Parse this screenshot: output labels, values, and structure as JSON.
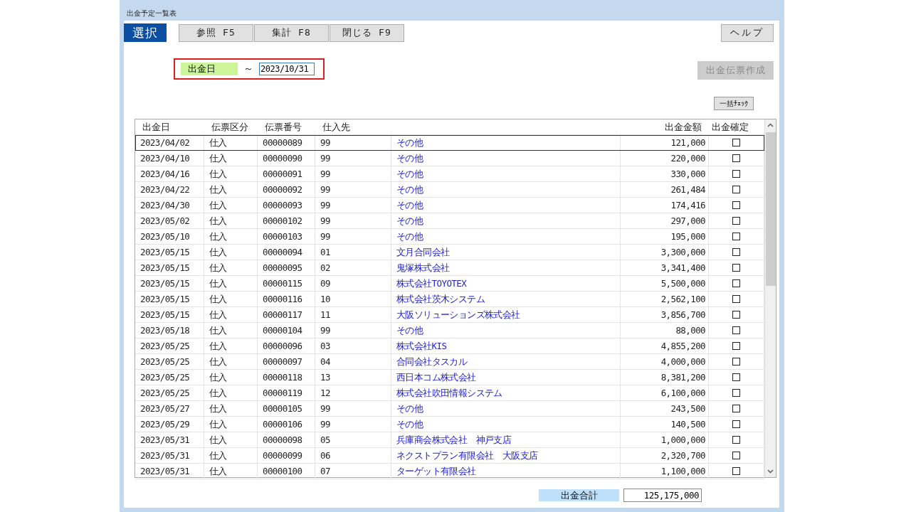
{
  "window": {
    "title": "出金予定一覧表"
  },
  "toolbar": [
    {
      "label": "選択",
      "selected": true
    },
    {
      "label": "参照 F5",
      "selected": false
    },
    {
      "label": "集計 F8",
      "selected": false
    },
    {
      "label": "閉じる F9",
      "selected": false
    }
  ],
  "help_button": "ヘルプ",
  "filter": {
    "label": "出金日",
    "separator": "～",
    "value": "2023/10/31"
  },
  "create_button": {
    "label": "出金伝票作成",
    "disabled": true
  },
  "bulk_check_button": "一括ﾁｪｯｸ",
  "table": {
    "columns": [
      "出金日",
      "伝票区分",
      "伝票番号",
      "仕入先",
      "出金金額",
      "出金確定"
    ],
    "rows": [
      {
        "date": "2023/04/02",
        "type": "仕入",
        "number": "00000089",
        "code": "99",
        "supplier": "その他",
        "amount": "121,000",
        "checked": false,
        "selected": true
      },
      {
        "date": "2023/04/10",
        "type": "仕入",
        "number": "00000090",
        "code": "99",
        "supplier": "その他",
        "amount": "220,000",
        "checked": false,
        "selected": false
      },
      {
        "date": "2023/04/16",
        "type": "仕入",
        "number": "00000091",
        "code": "99",
        "supplier": "その他",
        "amount": "330,000",
        "checked": false,
        "selected": false
      },
      {
        "date": "2023/04/22",
        "type": "仕入",
        "number": "00000092",
        "code": "99",
        "supplier": "その他",
        "amount": "261,484",
        "checked": false,
        "selected": false
      },
      {
        "date": "2023/04/30",
        "type": "仕入",
        "number": "00000093",
        "code": "99",
        "supplier": "その他",
        "amount": "174,416",
        "checked": false,
        "selected": false
      },
      {
        "date": "2023/05/02",
        "type": "仕入",
        "number": "00000102",
        "code": "99",
        "supplier": "その他",
        "amount": "297,000",
        "checked": false,
        "selected": false
      },
      {
        "date": "2023/05/10",
        "type": "仕入",
        "number": "00000103",
        "code": "99",
        "supplier": "その他",
        "amount": "195,000",
        "checked": false,
        "selected": false
      },
      {
        "date": "2023/05/15",
        "type": "仕入",
        "number": "00000094",
        "code": "01",
        "supplier": "文月合同会社",
        "amount": "3,300,000",
        "checked": false,
        "selected": false
      },
      {
        "date": "2023/05/15",
        "type": "仕入",
        "number": "00000095",
        "code": "02",
        "supplier": "鬼塚株式会社",
        "amount": "3,341,400",
        "checked": false,
        "selected": false
      },
      {
        "date": "2023/05/15",
        "type": "仕入",
        "number": "00000115",
        "code": "09",
        "supplier": "株式会社TOYOTEX",
        "amount": "5,500,000",
        "checked": false,
        "selected": false
      },
      {
        "date": "2023/05/15",
        "type": "仕入",
        "number": "00000116",
        "code": "10",
        "supplier": "株式会社茨木システム",
        "amount": "2,562,100",
        "checked": false,
        "selected": false
      },
      {
        "date": "2023/05/15",
        "type": "仕入",
        "number": "00000117",
        "code": "11",
        "supplier": "大阪ソリューションズ株式会社",
        "amount": "3,856,700",
        "checked": false,
        "selected": false
      },
      {
        "date": "2023/05/18",
        "type": "仕入",
        "number": "00000104",
        "code": "99",
        "supplier": "その他",
        "amount": "88,000",
        "checked": false,
        "selected": false
      },
      {
        "date": "2023/05/25",
        "type": "仕入",
        "number": "00000096",
        "code": "03",
        "supplier": "株式会社KIS",
        "amount": "4,855,200",
        "checked": false,
        "selected": false
      },
      {
        "date": "2023/05/25",
        "type": "仕入",
        "number": "00000097",
        "code": "04",
        "supplier": "合同会社タスカル",
        "amount": "4,000,000",
        "checked": false,
        "selected": false
      },
      {
        "date": "2023/05/25",
        "type": "仕入",
        "number": "00000118",
        "code": "13",
        "supplier": "西日本コム株式会社",
        "amount": "8,381,200",
        "checked": false,
        "selected": false
      },
      {
        "date": "2023/05/25",
        "type": "仕入",
        "number": "00000119",
        "code": "12",
        "supplier": "株式会社吹田情報システム",
        "amount": "6,100,000",
        "checked": false,
        "selected": false
      },
      {
        "date": "2023/05/27",
        "type": "仕入",
        "number": "00000105",
        "code": "99",
        "supplier": "その他",
        "amount": "243,500",
        "checked": false,
        "selected": false
      },
      {
        "date": "2023/05/29",
        "type": "仕入",
        "number": "00000106",
        "code": "99",
        "supplier": "その他",
        "amount": "140,500",
        "checked": false,
        "selected": false
      },
      {
        "date": "2023/05/31",
        "type": "仕入",
        "number": "00000098",
        "code": "05",
        "supplier": "兵庫商会株式会社　神戸支店",
        "amount": "1,000,000",
        "checked": false,
        "selected": false
      },
      {
        "date": "2023/05/31",
        "type": "仕入",
        "number": "00000099",
        "code": "06",
        "supplier": "ネクストプラン有限会社　大阪支店",
        "amount": "2,320,700",
        "checked": false,
        "selected": false
      },
      {
        "date": "2023/05/31",
        "type": "仕入",
        "number": "00000100",
        "code": "07",
        "supplier": "ターゲット有限会社",
        "amount": "1,100,000",
        "checked": false,
        "selected": false
      }
    ]
  },
  "total": {
    "label": "出金合計",
    "value": "125,175,000"
  }
}
